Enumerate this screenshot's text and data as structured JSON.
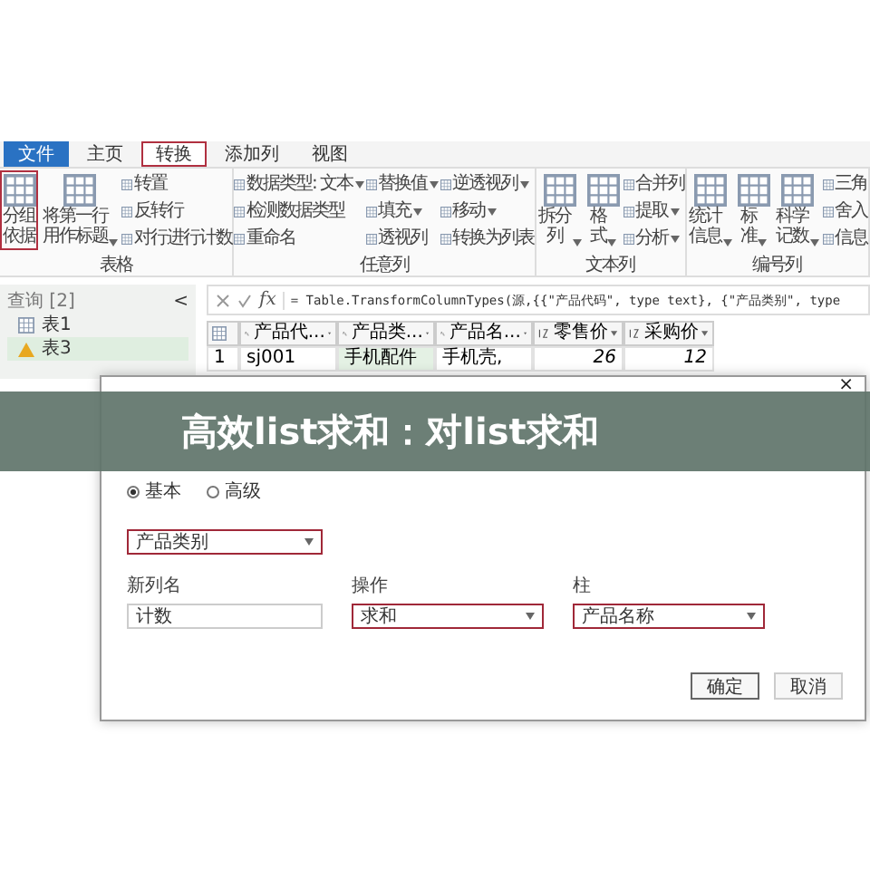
{
  "ribbon": {
    "tabs": [
      {
        "label": "文件",
        "kind": "file",
        "selected": false
      },
      {
        "label": "主页",
        "kind": "tab",
        "selected": false
      },
      {
        "label": "转换",
        "kind": "tab",
        "selected": true
      },
      {
        "label": "添加列",
        "kind": "tab",
        "selected": false
      },
      {
        "label": "视图",
        "kind": "tab",
        "selected": false
      }
    ],
    "groups": [
      {
        "label": "表格",
        "columns": [
          {
            "kind": "large",
            "items": [
              {
                "label": "分组依据",
                "dropdown": false,
                "highlighted": true
              }
            ]
          },
          {
            "kind": "large",
            "items": [
              {
                "label": "将第一行用作标题",
                "dropdown": true,
                "highlighted": false
              }
            ]
          },
          {
            "kind": "small",
            "items": [
              {
                "label": "转置",
                "dropdown": false
              },
              {
                "label": "反转行",
                "dropdown": false
              },
              {
                "label": "对行进行计数",
                "dropdown": false
              }
            ]
          }
        ]
      },
      {
        "label": "任意列",
        "columns": [
          {
            "kind": "small",
            "items": [
              {
                "label": "数据类型: 文本",
                "dropdown": true
              },
              {
                "label": "检测数据类型",
                "dropdown": false
              },
              {
                "label": "重命名",
                "dropdown": false
              }
            ]
          },
          {
            "kind": "small",
            "items": [
              {
                "label": "替换值",
                "dropdown": true
              },
              {
                "label": "填充",
                "dropdown": true
              },
              {
                "label": "透视列",
                "dropdown": false
              }
            ]
          },
          {
            "kind": "small",
            "items": [
              {
                "label": "逆透视列",
                "dropdown": true
              },
              {
                "label": "移动",
                "dropdown": true
              },
              {
                "label": "转换为列表",
                "dropdown": false
              }
            ]
          }
        ]
      },
      {
        "label": "文本列",
        "columns": [
          {
            "kind": "large",
            "items": [
              {
                "label": "拆分列",
                "dropdown": true,
                "highlighted": false
              }
            ]
          },
          {
            "kind": "large",
            "items": [
              {
                "label": "格式",
                "dropdown": true,
                "highlighted": false
              }
            ]
          },
          {
            "kind": "small",
            "items": [
              {
                "label": "合并列",
                "dropdown": false
              },
              {
                "label": "提取",
                "dropdown": true
              },
              {
                "label": "分析",
                "dropdown": true
              }
            ]
          }
        ]
      },
      {
        "label": "编号列",
        "columns": [
          {
            "kind": "large",
            "items": [
              {
                "label": "统计信息",
                "dropdown": true,
                "highlighted": false
              }
            ]
          },
          {
            "kind": "large",
            "items": [
              {
                "label": "标准",
                "dropdown": true,
                "highlighted": false
              }
            ]
          },
          {
            "kind": "large",
            "items": [
              {
                "label": "科学记数",
                "dropdown": true,
                "highlighted": false
              }
            ]
          },
          {
            "kind": "small",
            "items": [
              {
                "label": "三角",
                "dropdown": false
              },
              {
                "label": "舍入",
                "dropdown": false
              },
              {
                "label": "信息",
                "dropdown": false
              }
            ]
          }
        ]
      }
    ]
  },
  "queries": {
    "title": "查询 [2]",
    "collapse": "<",
    "items": [
      {
        "label": "表1",
        "kind": "table",
        "selected": false
      },
      {
        "label": "表3",
        "kind": "warning",
        "selected": true
      }
    ]
  },
  "formula_bar": {
    "fx": "fx",
    "formula": "= Table.TransformColumnTypes(源,{{\"产品代码\", type text}, {\"产品类别\", type"
  },
  "table": {
    "columns": [
      {
        "label": "产品代...",
        "kind": "text",
        "selected": false
      },
      {
        "label": "产品类...",
        "kind": "text",
        "selected": true
      },
      {
        "label": "产品名...",
        "kind": "text",
        "selected": false
      },
      {
        "label": "零售价",
        "kind": "number",
        "selected": false
      },
      {
        "label": "采购价",
        "kind": "number",
        "selected": false
      }
    ],
    "rows": [
      {
        "index": "1",
        "cells": [
          "sj001",
          "手机配件",
          "手机壳,",
          "26",
          "12"
        ]
      }
    ]
  },
  "dialog": {
    "close": "×",
    "modes": [
      {
        "label": "基本",
        "selected": true
      },
      {
        "label": "高级",
        "selected": false
      }
    ],
    "group_field": {
      "value": "产品类别",
      "highlighted": true
    },
    "fields": [
      {
        "label": "新列名",
        "kind": "input",
        "value": "计数",
        "highlighted": false
      },
      {
        "label": "操作",
        "kind": "select",
        "value": "求和",
        "highlighted": true
      },
      {
        "label": "柱",
        "kind": "select",
        "value": "产品名称",
        "highlighted": true
      }
    ],
    "buttons": [
      {
        "label": "确定",
        "primary": true
      },
      {
        "label": "取消",
        "primary": false
      }
    ]
  },
  "banner": {
    "text": "高效list求和：对list求和"
  }
}
